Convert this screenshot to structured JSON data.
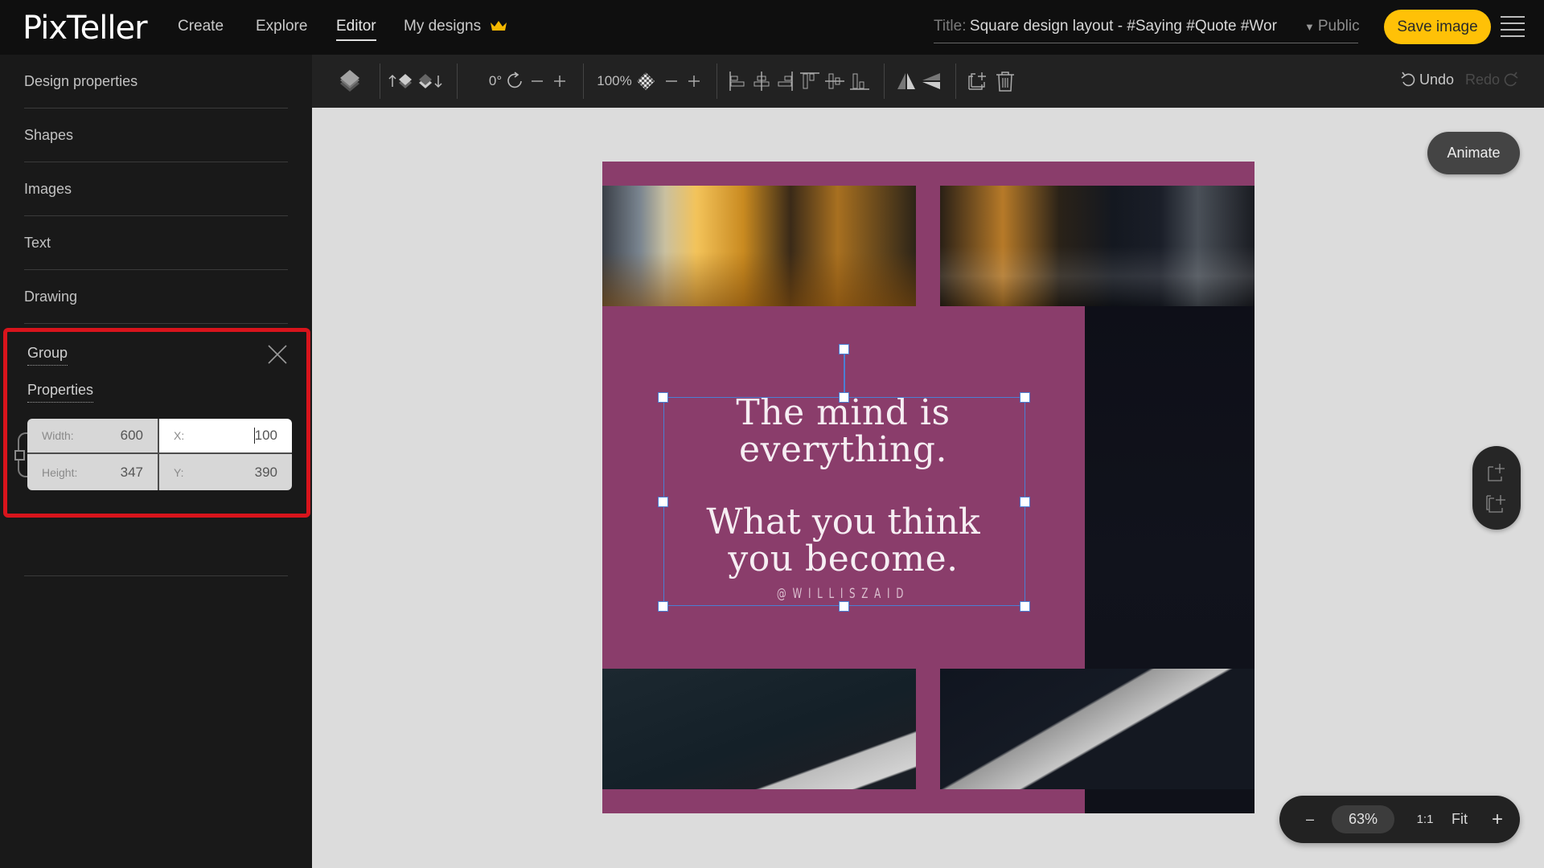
{
  "app": {
    "logo": "PixTeller",
    "nav": [
      {
        "label": "Create",
        "active": false
      },
      {
        "label": "Explore",
        "active": false
      },
      {
        "label": "Editor",
        "active": true
      },
      {
        "label": "My designs",
        "active": false
      }
    ],
    "title_label": "Title:",
    "title_value": "Square design layout - #Saying #Quote #Wor",
    "visibility": "Public",
    "save_label": "Save image",
    "accent_color": "#ffc107"
  },
  "sidebar": {
    "items": [
      {
        "label": "Design properties"
      },
      {
        "label": "Shapes"
      },
      {
        "label": "Images"
      },
      {
        "label": "Text"
      },
      {
        "label": "Drawing"
      }
    ],
    "group_panel": {
      "title": "Group",
      "properties_title": "Properties",
      "fields": {
        "width_label": "Width:",
        "width_value": "600",
        "height_label": "Height:",
        "height_value": "347",
        "x_label": "X:",
        "x_value": "100",
        "y_label": "Y:",
        "y_value": "390"
      },
      "highlight_color": "#d8141c"
    }
  },
  "toolbar": {
    "rotation": "0°",
    "opacity": "100%",
    "undo_label": "Undo",
    "redo_label": "Redo",
    "icons": [
      "layers-icon",
      "bring-forward-icon",
      "send-backward-icon",
      "rotate-icon",
      "rotate-minus-icon",
      "rotate-plus-icon",
      "transparency-icon",
      "opacity-minus-icon",
      "opacity-plus-icon",
      "align-left-icon",
      "align-center-icon",
      "align-right-icon",
      "align-top-icon",
      "align-middle-icon",
      "align-bottom-icon",
      "flip-horizontal-icon",
      "flip-vertical-icon",
      "duplicate-icon",
      "delete-icon"
    ]
  },
  "canvas": {
    "background_color": "#8a3d6b",
    "quote_line1": "The mind is",
    "quote_line2": "everything.",
    "quote_line3": "What you think",
    "quote_line4": "you become.",
    "author": "@WILLISZAID",
    "animate_label": "Animate"
  },
  "zoom_controls": {
    "minus": "–",
    "value": "63%",
    "one_to_one": "1:1",
    "fit": "Fit",
    "plus": "+"
  }
}
